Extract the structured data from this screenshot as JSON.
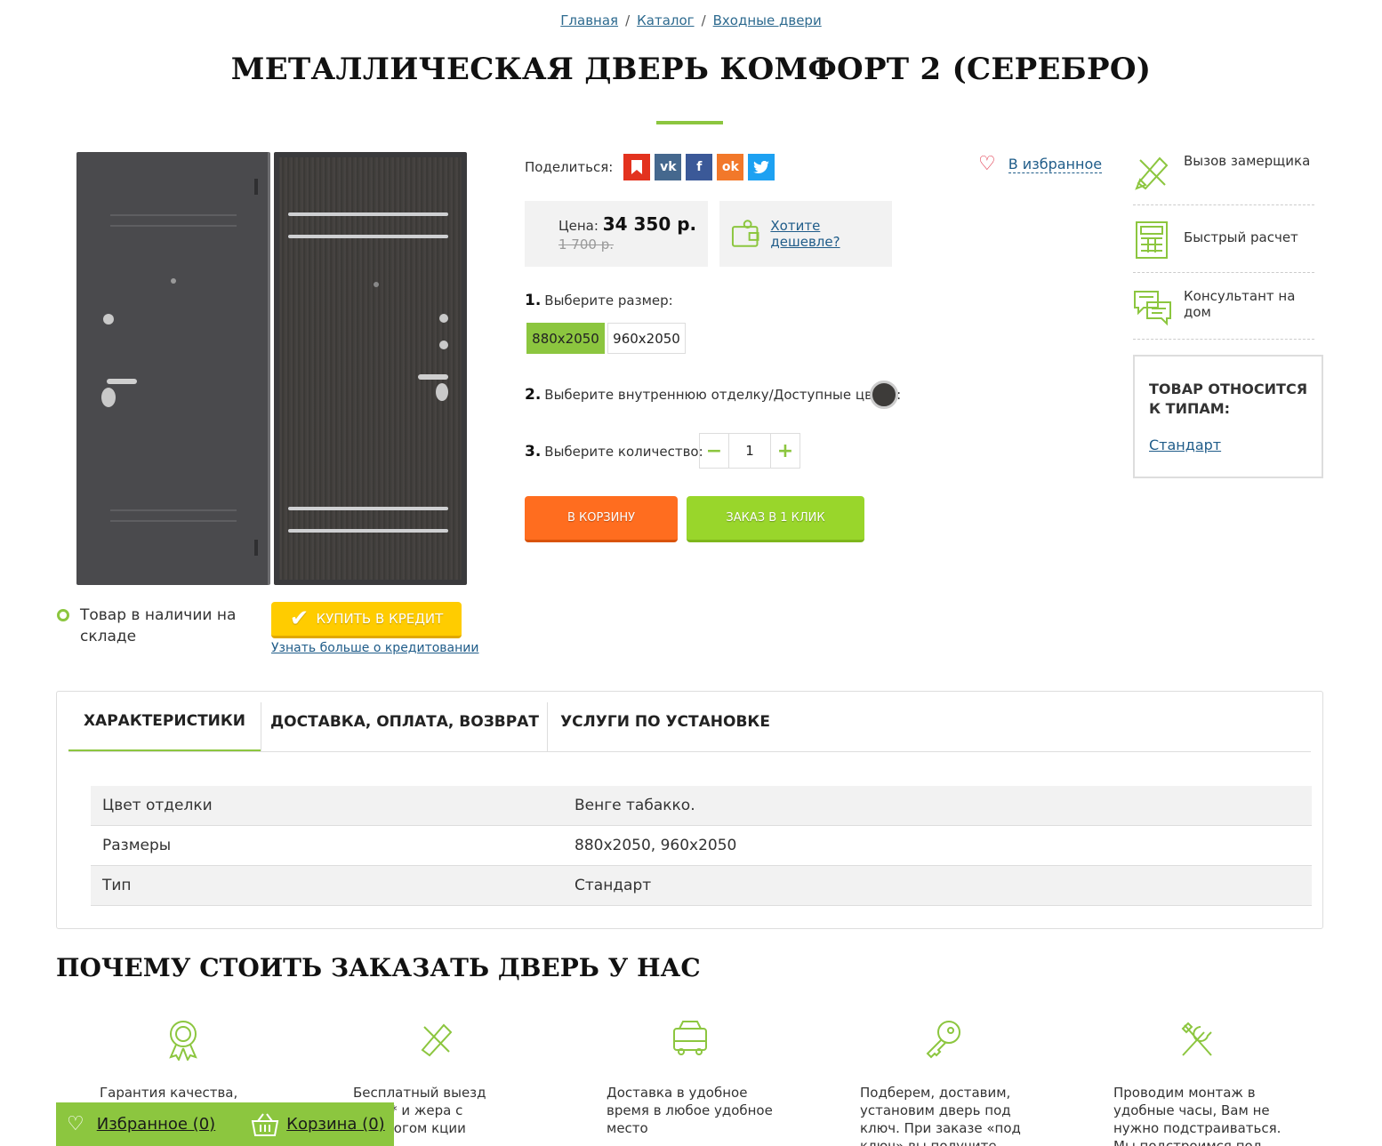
{
  "breadcrumb": {
    "home": "Главная",
    "catalog": "Каталог",
    "current": "Входные двери"
  },
  "product": {
    "title": "МЕТАЛЛИЧЕСКАЯ ДВЕРЬ КОМФОРТ 2 (СЕРЕБРО)",
    "stock": "Товар в наличии на складе",
    "credit_button": "КУПИТЬ В КРЕДИТ",
    "credit_link": "Узнать больше о кредитовании",
    "share_label": "Поделиться:",
    "favorite": "В избранное",
    "price_label": "Цена:",
    "price": "34 350 р.",
    "old_price": "1 700 р.",
    "cheaper": "Хотите дешевле?",
    "step1_num": "1.",
    "step1": "Выберите размер:",
    "sizes": [
      "880x2050",
      "960x2050"
    ],
    "step2_num": "2.",
    "step2": "Выберите внутреннюю отделку/Доступные цвета:",
    "swatch_color": "#3d3b39",
    "step3_num": "3.",
    "step3": "Выберите количество:",
    "quantity": "1",
    "cart_button": "В КОРЗИНУ",
    "oneclick_button": "ЗАКАЗ В 1 КЛИК"
  },
  "services": [
    "Вызов замерщика",
    "Быстрый расчет",
    "Консультант на дом"
  ],
  "types": {
    "heading": "ТОВАР ОТНОСИТСЯ К ТИПАМ:",
    "link": "Стандарт"
  },
  "tabs": [
    "ХАРАКТЕРИСТИКИ",
    "ДОСТАВКА, ОПЛАТА, ВОЗВРАТ",
    "УСЛУГИ ПО УСТАНОВКЕ"
  ],
  "specs": [
    {
      "key": "Цвет отделки",
      "value": "Венге табакко."
    },
    {
      "key": "Размеры",
      "value": "880x2050, 960x2050"
    },
    {
      "key": "Тип",
      "value": "Стандарт"
    }
  ],
  "why": {
    "heading": "ПОЧЕМУ СТОИТЬ ЗАКАЗАТЬ ДВЕРЬ У НАС",
    "features": [
      "Гарантия качества,",
      "Бесплатный выезд щика* и жера с каталогом кции",
      "Доставка в удобное время в любое удобное место",
      "Подберем, доставим, установим дверь под ключ. При заказе «под ключ» вы получите",
      "Проводим монтаж в удобные часы, Вам не нужно подстраиваться. Мы подстроимся под вас!"
    ]
  },
  "bottom_bar": {
    "favorites": "Избранное (0)",
    "cart": "Корзина (0)"
  },
  "colors": {
    "accent": "#8cc63f",
    "orange": "#ff6d1f",
    "yellow": "#ffcc00",
    "link": "#1f5c89"
  }
}
